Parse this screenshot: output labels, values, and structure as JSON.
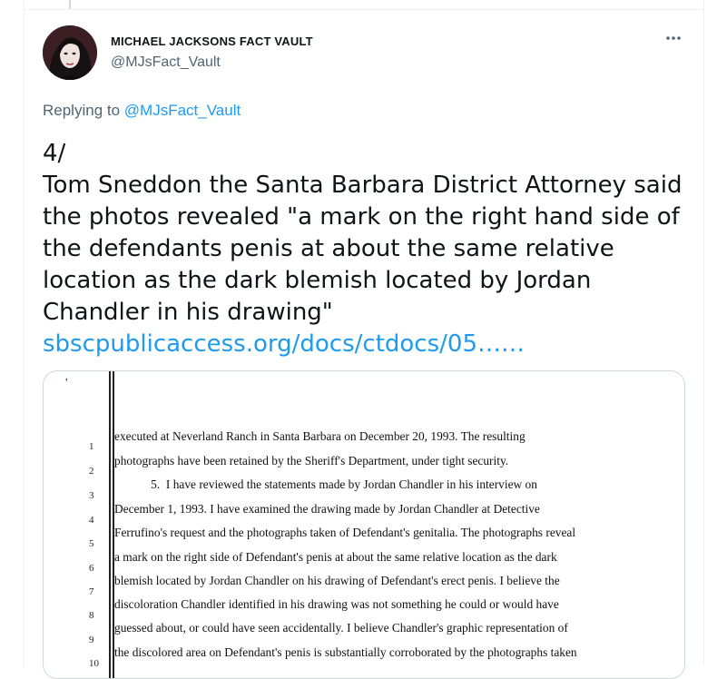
{
  "author": {
    "display_name": "MICHAEL JACKSONS FACT VAULT",
    "handle": "@MJsFact_Vault",
    "avatar_icon": "profile-photo"
  },
  "more_icon": "more-horizontal-icon",
  "reply": {
    "prefix": "Replying to",
    "mention": "@MJsFact_Vault"
  },
  "tweet": {
    "lines": [
      "4/",
      "Tom Sneddon the Santa Barbara District Attorney said",
      "the photos revealed \"a mark on the right hand side of",
      "the defendants penis at about the same relative",
      "location as the dark blemish located by Jordan",
      "Chandler in his drawing\""
    ],
    "link": "sbscpublicaccess.org/docs/ctdocs/05……"
  },
  "document": {
    "tick_mark": "'",
    "line_numbers": [
      "1",
      "2",
      "3",
      "4",
      "5",
      "6",
      "7",
      "8",
      "9",
      "10"
    ],
    "lines": [
      "executed at Neverland Ranch in Santa Barbara on December 20, 1993.  The resulting",
      "photographs have been retained by the Sheriff's Department, under tight security.",
      "            5.  I have reviewed the statements made by Jordan Chandler in his interview on",
      "December 1, 1993.  I have examined the drawing made by Jordan Chandler at Detective",
      "Ferrufino's request and the photographs taken of Defendant's genitalia.  The photographs reveal",
      "a mark on the right side of Defendant's penis at about the same relative location as the dark",
      "blemish located by Jordan Chandler on his drawing of Defendant's erect penis.  I believe the",
      "discoloration Chandler identified in his drawing was not something he could or would have",
      "guessed about, or could have seen accidentally.  I believe Chandler's graphic representation of",
      "the discolored area on Defendant's penis is substantially corroborated by the photographs taken"
    ]
  },
  "colors": {
    "link": "#1d9bf0",
    "secondary_text": "#536471",
    "primary_text": "#0f1419",
    "border": "#cfd9de"
  }
}
